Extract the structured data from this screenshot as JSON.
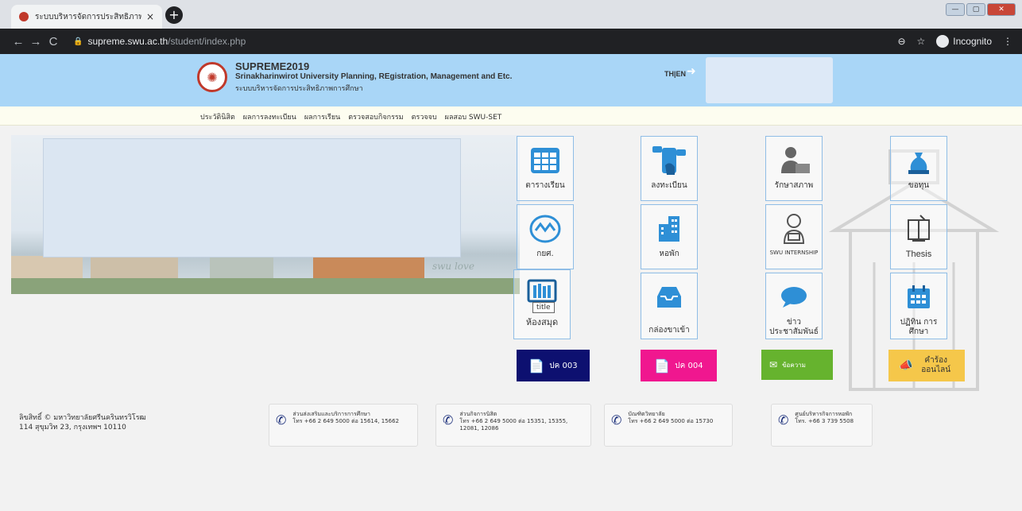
{
  "browser": {
    "tab_title": "ระบบบริหารจัดการประสิทธิภาพการศึก",
    "tab_close": "×",
    "new_tab": "+",
    "url_host": "supreme.swu.ac.th",
    "url_path": "/student/index.php",
    "incognito_label": "Incognito",
    "back": "←",
    "forward": "→",
    "reload": "C",
    "zoom": "⊖",
    "star": "☆",
    "menu": "⋮"
  },
  "header": {
    "title": "SUPREME2019",
    "subtitle_en": "Srinakharinwirot University Planning, REgistration, Management and Etc.",
    "subtitle_th": "ระบบบริหารจัดการประสิทธิภาพการศึกษา",
    "lang": "TH|EN"
  },
  "menu": [
    "ประวัตินิสิต",
    "ผลการลงทะเบียน",
    "ผลการเรียน",
    "ตรวจสอบกิจกรรม",
    "ตรวจจบ",
    "ผลสอบ SWU-SET"
  ],
  "banner_text": "swu love",
  "tiles": [
    {
      "label": "ตารางเรียน",
      "icon": "grid-calendar-icon"
    },
    {
      "label": "ลงทะเบียน",
      "icon": "phone-register-icon"
    },
    {
      "label": "รักษาสภาพ",
      "icon": "person-desk-icon"
    },
    {
      "label": "ขอทุน",
      "icon": "money-bag-icon"
    },
    {
      "label": "กยศ.",
      "icon": "kyc-logo-icon"
    },
    {
      "label": "หอพัก",
      "icon": "building-icon"
    },
    {
      "label": "SWU INTERNSHIP",
      "icon": "intern-icon"
    },
    {
      "label": "Thesis",
      "icon": "thesis-icon"
    },
    {
      "label": "ห้องสมุด",
      "icon": "library-icon"
    },
    {
      "label": "กล่องขาเข้า",
      "icon": "inbox-icon"
    },
    {
      "label": "ข่าว ประชาสัมพันธ์",
      "icon": "chat-icon"
    },
    {
      "label": "ปฏิทิน การศึกษา",
      "icon": "calendar-icon"
    }
  ],
  "tooltip": "title",
  "color_buttons": [
    {
      "label": "ปค 003",
      "color": "#0d1070"
    },
    {
      "label": "ปค 004",
      "color": "#f0178f"
    },
    {
      "label": "ข้อความ",
      "color": "#66b32e"
    },
    {
      "label": "คำร้อง ออนไลน์",
      "color": "#f5c74a"
    }
  ],
  "footer": {
    "copyright": "ลิขสิทธิ์ © มหาวิทยาลัยศรีนครินทรวิโรฒ",
    "address": "114 สุขุมวิท 23, กรุงเทพฯ 10110",
    "contacts": [
      {
        "name": "ส่วนส่งเสริมและบริการการศึกษา",
        "phone": "โทร +66 2 649 5000 ต่อ 15614, 15662"
      },
      {
        "name": "ส่วนกิจการนิสิต",
        "phone": "โทร +66 2 649 5000 ต่อ 15351, 15355, 12081, 12086"
      },
      {
        "name": "บัณฑิตวิทยาลัย",
        "phone": "โทร +66 2 649 5000 ต่อ 15730"
      },
      {
        "name": "ศูนย์บริหารกิจการหอพัก",
        "phone": "โทร. +66 3 739 5508"
      }
    ]
  }
}
